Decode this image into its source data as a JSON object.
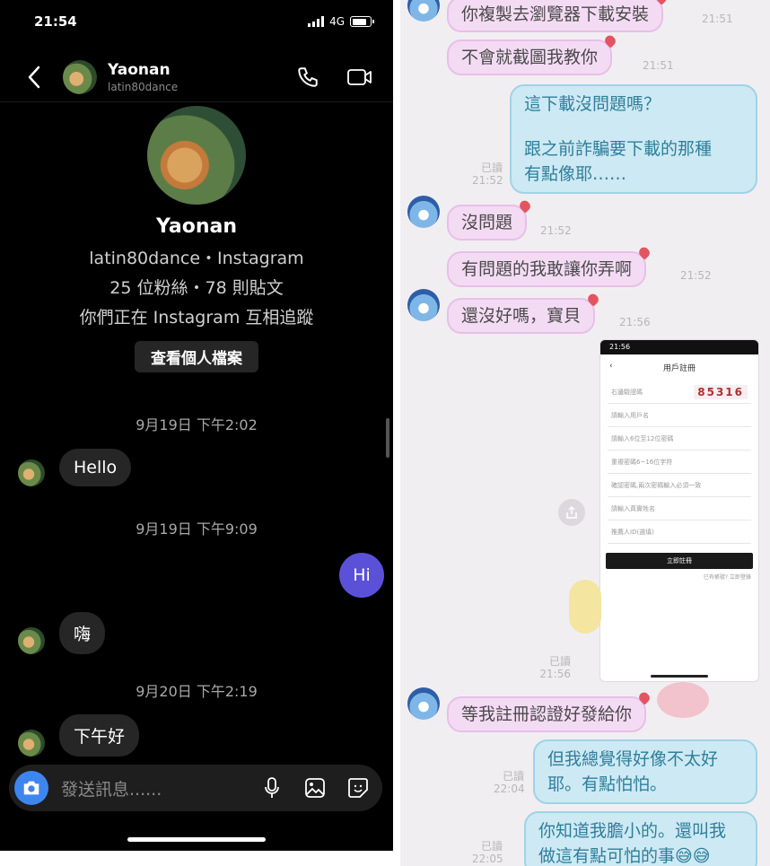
{
  "instagram": {
    "status": {
      "time": "21:54",
      "network": "4G"
    },
    "header": {
      "name": "Yaonan",
      "username": "latin80dance"
    },
    "profile": {
      "name": "Yaonan",
      "line1": "latin80dance・Instagram",
      "line2": "25 位粉絲・78 則貼文",
      "line3": "你們正在 Instagram 互相追蹤",
      "view_button": "查看個人檔案"
    },
    "messages": {
      "stamp1": "9月19日 下午2:02",
      "msg1": "Hello",
      "stamp2": "9月19日 下午9:09",
      "msg2_out": "Hi",
      "msg3": "嗨",
      "stamp3": "9月20日 下午2:19",
      "msg4": "下午好"
    },
    "composer": {
      "placeholder": "發送訊息......"
    }
  },
  "line_chat": {
    "m1": "你複製去瀏覽器下載安裝",
    "m1_time": "21:51",
    "m2": "不會就截圖我教你",
    "m2_time": "21:51",
    "m3_line1": "這下載沒問題嗎？",
    "m3_line2": "跟之前詐騙要下載的那種",
    "m3_line3": "有點像耶……",
    "m3_read": "已讀",
    "m3_time": "21:52",
    "m4": "沒問題",
    "m4_time": "21:52",
    "m5": "有問題的我敢讓你弄啊",
    "m5_time": "21:52",
    "m6": "還沒好嗎，寶貝",
    "m6_time": "21:56",
    "shot": {
      "time": "21:56",
      "title": "用戶註冊",
      "captcha_label": "右邊驗證碼",
      "captcha": "85316",
      "f1": "請輸入用戶名",
      "f2": "請輸入6位至12位密碼",
      "f3": "重複密碼6~16位字符",
      "f4": "確認密碼,兩次密碼輸入必須一致",
      "f5": "請輸入真實姓名",
      "f6": "推薦人ID(選填)",
      "submit": "立即註冊",
      "foot": "已有帳號? 立即登錄"
    },
    "sticker_read": "已讀",
    "sticker_time": "21:56",
    "sticker_time2": "22:04",
    "m7": "等我註冊認證好發給你",
    "m8_line1": "但我總覺得好像不太好",
    "m8_line2": "耶。有點怕怕。",
    "m8_read": "已讀",
    "m8_time": "22:04",
    "m9_line1": "你知道我膽小的。還叫我",
    "m9_line2": "做這有點可怕的事😅😅",
    "m9_read": "已讀",
    "m9_time": "22:05",
    "colors": {
      "incoming_bubble": "#f4dbf4",
      "outgoing_bubble": "#cde9f3",
      "outgoing_text": "#2f7f9b"
    }
  }
}
